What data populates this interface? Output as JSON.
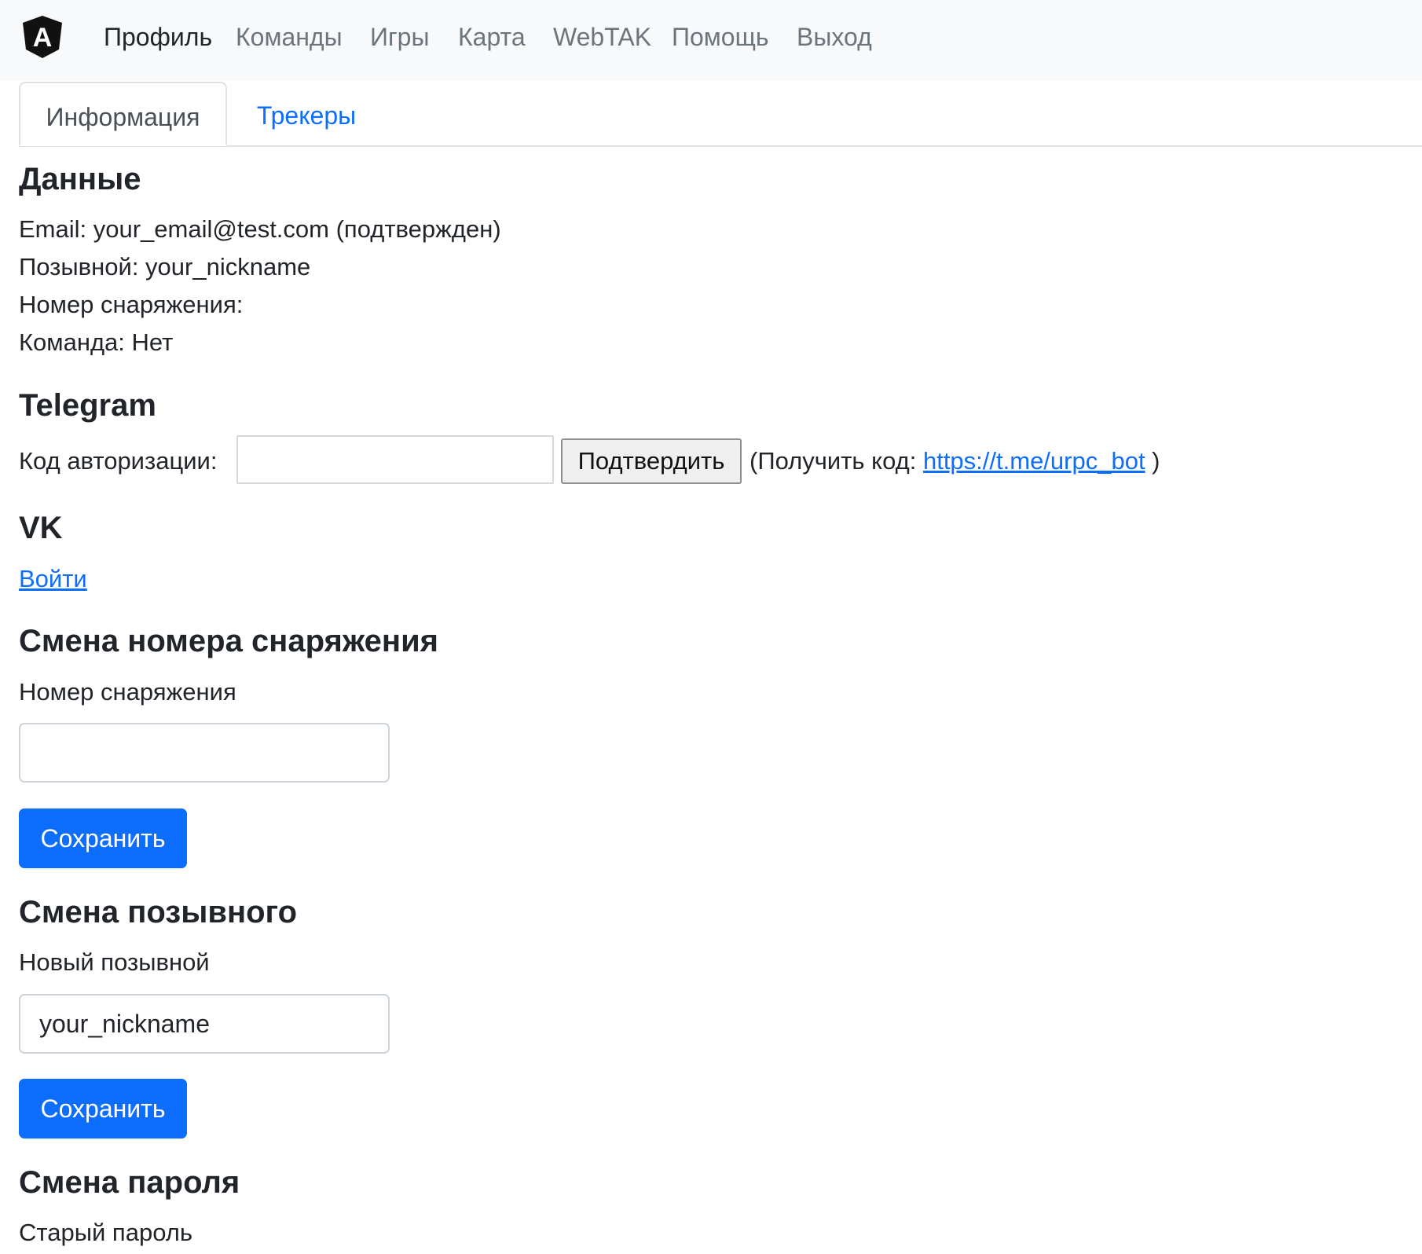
{
  "navbar": {
    "logo_letter": "A",
    "items": [
      "Профиль",
      "Команды",
      "Игры",
      "Карта",
      "WebTAK",
      "Помощь",
      "Выход"
    ]
  },
  "tabs": [
    "Информация",
    "Трекеры"
  ],
  "data_section": {
    "title": "Данные",
    "email_line": "Email: your_email@test.com (подтвержден)",
    "nickname_line": "Позывной: your_nickname",
    "equipment_line": "Номер снаряжения:",
    "team_line": "Команда: Нет"
  },
  "telegram": {
    "title": "Telegram",
    "code_label": "Код авторизации:",
    "code_value": "",
    "confirm_button": "Подтвердить",
    "get_code_prefix": "(Получить код: ",
    "bot_link": "https://t.me/urpc_bot",
    "get_code_suffix": " )"
  },
  "vk": {
    "title": "VK",
    "login_link": "Войти"
  },
  "equipment_change": {
    "title": "Смена номера снаряжения",
    "label": "Номер снаряжения",
    "value": "",
    "save_button": "Сохранить"
  },
  "nickname_change": {
    "title": "Смена позывного",
    "label": "Новый позывной",
    "value": "your_nickname",
    "save_button": "Сохранить"
  },
  "password_change": {
    "title": "Смена пароля",
    "old_password_label": "Старый пароль"
  },
  "colors": {
    "primary": "#0d6efd",
    "navbar_bg": "#f8f9fa",
    "muted_nav": "#6c757d"
  }
}
